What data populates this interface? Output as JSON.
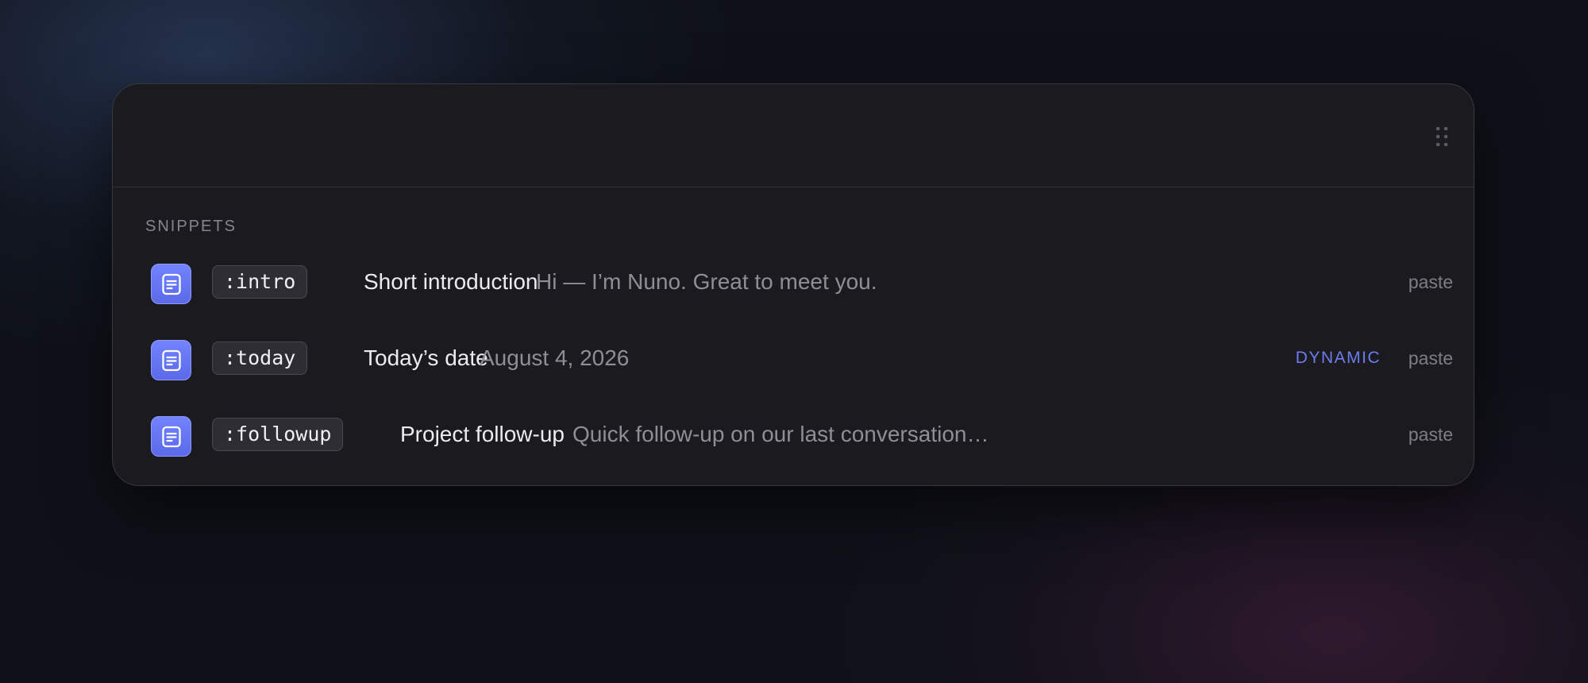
{
  "search": {
    "placeholder": "",
    "value": ""
  },
  "section": {
    "label": "SNIPPETS"
  },
  "snippets": [
    {
      "icon": "document-icon",
      "keyword": ":intro",
      "title": "Short introduction",
      "preview": "Hi — I’m Nuno. Great to meet you.",
      "badge": "",
      "action": "paste"
    },
    {
      "icon": "document-icon",
      "keyword": ":today",
      "title": "Today’s date",
      "preview": "August 4, 2026",
      "badge": "DYNAMIC",
      "action": "paste"
    },
    {
      "icon": "document-icon",
      "keyword": ":followup",
      "title": "Project follow-up",
      "preview": "Quick follow-up on our last conversation…",
      "badge": "",
      "action": "paste"
    }
  ],
  "colors": {
    "accent": "#6c7cf0",
    "icon_background": "#6373f5",
    "panel_background": "#1b1b1f"
  }
}
